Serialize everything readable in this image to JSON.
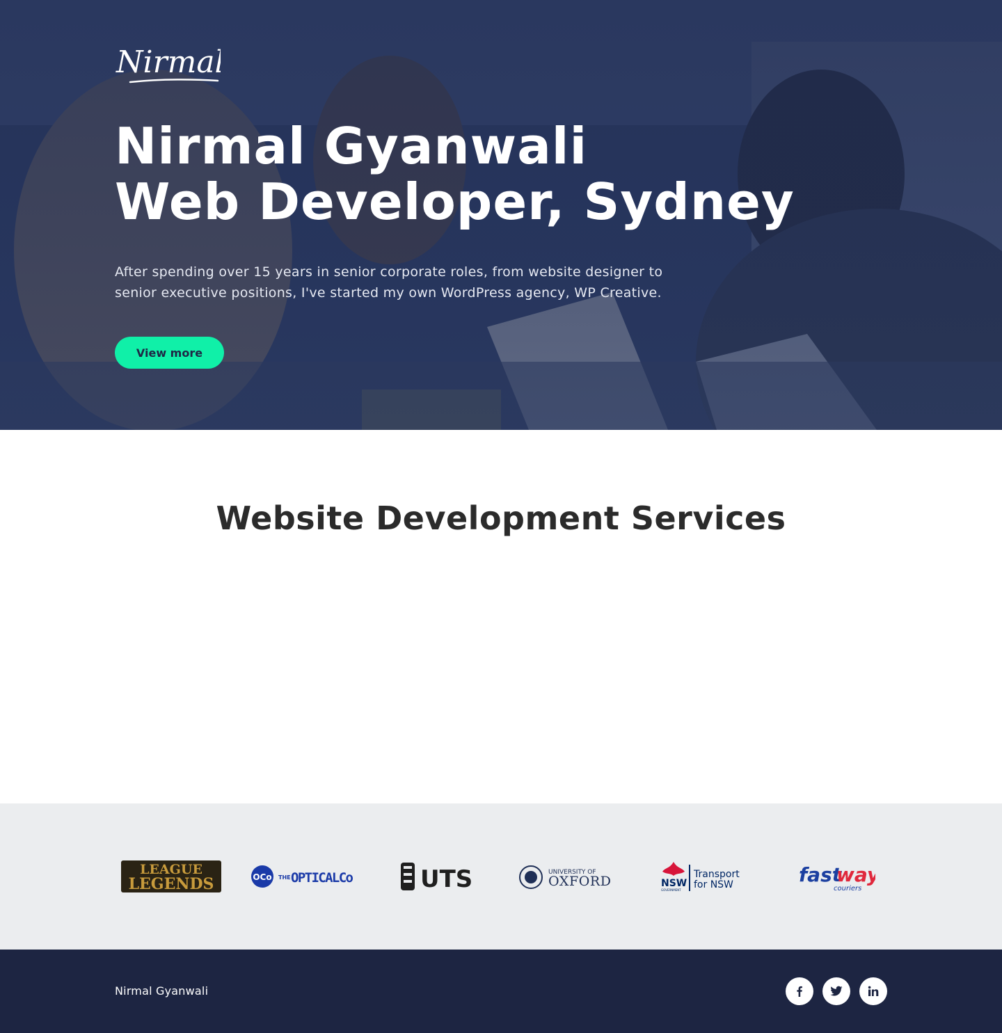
{
  "hero": {
    "logo_text": "Nirmal",
    "title_line1": "Nirmal Gyanwali",
    "title_line2": "Web Developer, Sydney",
    "lead": "After spending over 15 years in senior corporate roles, from website designer to senior executive positions, I've started my own WordPress agency, WP Creative.",
    "button_label": "View more"
  },
  "services": {
    "title": "Website Development Services"
  },
  "clients": {
    "logos": [
      {
        "name": "League of Legends",
        "line1": "LEAGUE",
        "line2": "LEGENDS"
      },
      {
        "name": "The Optical Co",
        "mark": "OCo",
        "text_the": "THE",
        "text_main": "OPTICALCo"
      },
      {
        "name": "UTS",
        "text": "UTS"
      },
      {
        "name": "University of Oxford",
        "line1": "UNIVERSITY OF",
        "line2": "OXFORD"
      },
      {
        "name": "Transport for NSW",
        "nsw": "NSW",
        "gov": "GOVERNMENT",
        "line1": "Transport",
        "line2": "for NSW"
      },
      {
        "name": "Fastway Couriers",
        "fast": "fast",
        "way": "way",
        "sub": "couriers"
      }
    ]
  },
  "footer": {
    "name": "Nirmal Gyanwali",
    "social": [
      {
        "name": "facebook",
        "glyph": "f"
      },
      {
        "name": "twitter",
        "glyph": "twitter-icon"
      },
      {
        "name": "linkedin",
        "glyph": "in"
      }
    ]
  },
  "colors": {
    "accent": "#10f0a8",
    "hero_overlay": "#1e2a4e",
    "footer_bg": "#1d2542",
    "clients_bg": "#ebedef"
  }
}
